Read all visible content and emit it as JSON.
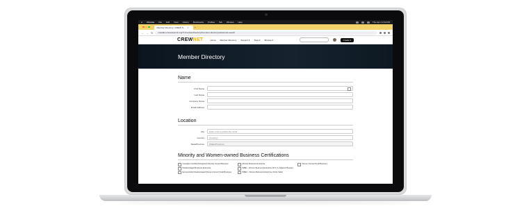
{
  "menubar": {
    "app": "Chrome",
    "items": [
      "File",
      "Edit",
      "View",
      "History",
      "Bookmarks",
      "Profiles",
      "Tab",
      "Window",
      "Help"
    ],
    "clock": "Thu Apr 4  2:34 PM"
  },
  "browser": {
    "tab_title": "Member Directory | CREW N...",
    "url": "crewfam.crewnetwork.org/?=/memberdirectory#member-directory/advanced-search"
  },
  "site": {
    "logo_main": "CREW",
    "logo_accent": "NET",
    "nav": [
      "Home",
      "Member Directory",
      "Support ▾",
      "Tools ▾",
      "Browse ▾"
    ],
    "create_label": "Create ▾"
  },
  "hero": {
    "title": "Member Directory"
  },
  "name_section": {
    "heading": "Name",
    "fields": [
      {
        "label": "First Name",
        "value": ""
      },
      {
        "label": "Last Name",
        "value": ""
      },
      {
        "label": "Company Name",
        "value": ""
      },
      {
        "label": "Email Address",
        "value": ""
      }
    ]
  },
  "location_section": {
    "heading": "Location",
    "city_label": "City",
    "city_placeholder": "Enter a list to partial city name",
    "country_label": "Country",
    "country_value": "(Country)",
    "state_label": "State/Province",
    "state_value": "(State/Province)"
  },
  "certs_section": {
    "heading": "Minority and Women-owned Business Certifications",
    "items": [
      "Canadian Certified Aboriginal & Minority Owned Business",
      "Minority Business Enterprise",
      "Women Owned Small Business",
      "Disadvantaged Business Enterprise",
      "WBEc - Women Business Enterprise (WI U.S. Adjacent Bureau)",
      "",
      "Economically Disadvantaged Women-Owned Small Business",
      "WBEC - Women Business Enterprise (Circle State)",
      ""
    ]
  },
  "colors": {
    "tab_bar": "#f3d36a",
    "hero_bg": "#0b1520",
    "logo_accent": "#f0b400"
  }
}
